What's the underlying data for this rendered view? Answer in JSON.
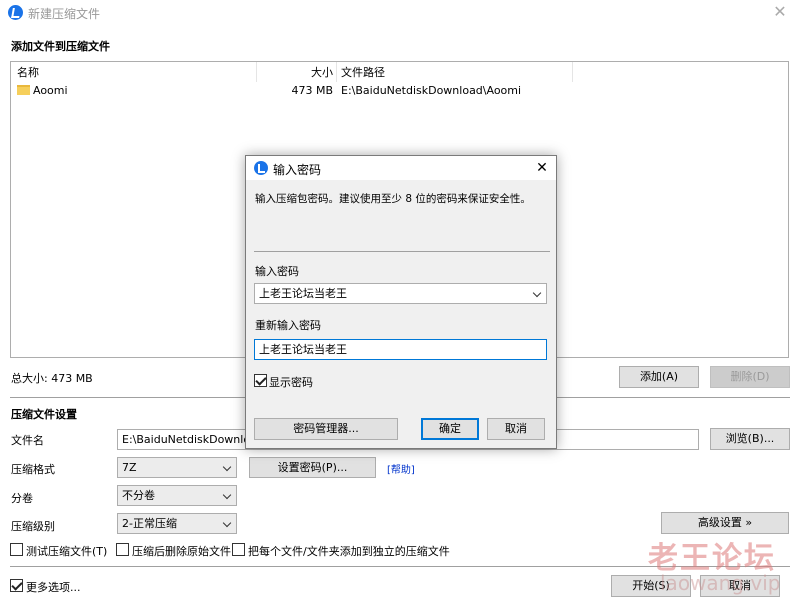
{
  "window": {
    "title": "新建压缩文件",
    "close_glyph": "✕"
  },
  "add_section": {
    "heading": "添加文件到压缩文件",
    "columns": {
      "name": "名称",
      "size": "大小",
      "path": "文件路径"
    },
    "rows": [
      {
        "name": "Aoomi",
        "size": "473 MB",
        "path": "E:\\BaiduNetdiskDownload\\Aoomi",
        "icon": "folder-icon"
      }
    ],
    "total_size": "总大小: 473 MB",
    "add_button": "添加(A)",
    "delete_button": "删除(D)"
  },
  "settings": {
    "heading": "压缩文件设置",
    "filename_label": "文件名",
    "filename_value": "E:\\BaiduNetdiskDownload\\",
    "browse_button": "浏览(B)...",
    "format_label": "压缩格式",
    "format_value": "7Z",
    "set_password_button": "设置密码(P)...",
    "help_link": "[帮助]",
    "split_label": "分卷",
    "split_value": "不分卷",
    "level_label": "压缩级别",
    "level_value": "2-正常压缩",
    "advanced_button": "高级设置 »",
    "test_checkbox": "测试压缩文件(T)",
    "delete_after_checkbox": "压缩后删除原始文件",
    "separate_checkbox": "把每个文件/文件夹添加到独立的压缩文件",
    "more_options_checkbox": "更多选项...",
    "start_button": "开始(S)",
    "cancel_button": "取消"
  },
  "password_dialog": {
    "title": "输入密码",
    "close_glyph": "✕",
    "description": "输入压缩包密码。建议使用至少 8 位的密码来保证安全性。",
    "password_label": "输入密码",
    "password_value": "上老王论坛当老王",
    "reenter_label": "重新输入密码",
    "reenter_value": "上老王论坛当老王",
    "show_password": "显示密码",
    "manager_button": "密码管理器...",
    "ok_button": "确定",
    "cancel_button": "取消"
  },
  "watermark": {
    "line1": "老王论坛",
    "line2": "laowang.vip"
  },
  "colors": {
    "accent": "#0078d7",
    "app_icon": "#1a73e8",
    "folder": "#f6cf5b",
    "link": "#0033cc"
  }
}
